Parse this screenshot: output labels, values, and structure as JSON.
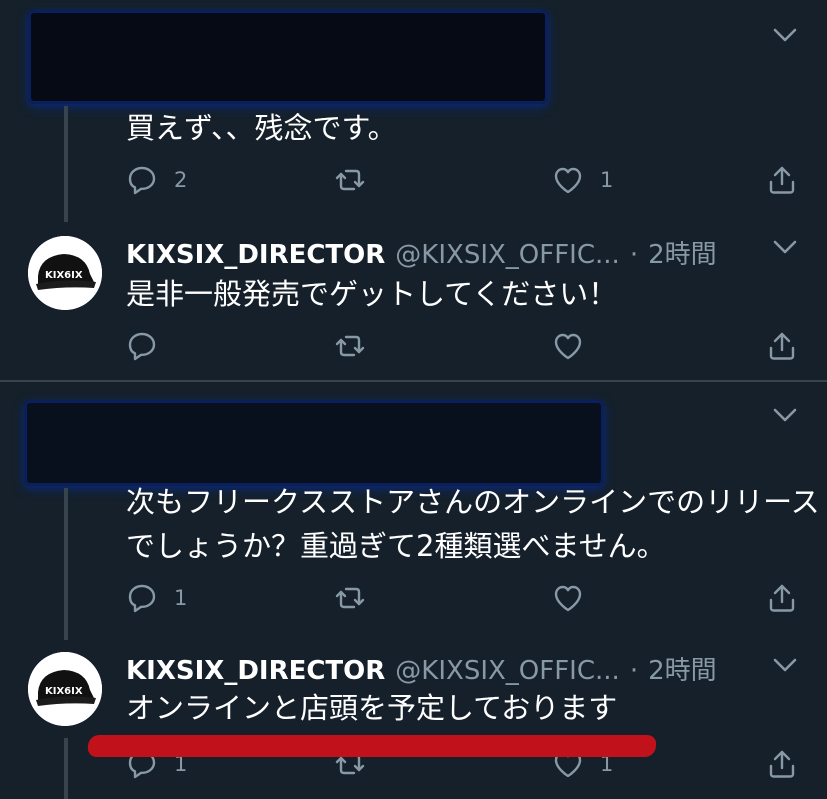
{
  "tweets": [
    {
      "text_lines": [
        "買えず、、残念です。"
      ],
      "reply_count": "2",
      "retweet_count": "",
      "like_count": "1"
    },
    {
      "author_name": "KIXSIX_DIRECTOR",
      "author_handle": "@KIXSIX_OFFIC...",
      "separator": "·",
      "time": "2時間",
      "text_lines": [
        "是非一般発売でゲットしてください！"
      ],
      "reply_count": "",
      "retweet_count": "",
      "like_count": ""
    },
    {
      "text_lines": [
        "次もフリークスストアさんのオンラインでのリリース",
        "でしょうか？重過ぎて2種類選べません。"
      ],
      "reply_count": "1",
      "retweet_count": "",
      "like_count": ""
    },
    {
      "author_name": "KIXSIX_DIRECTOR",
      "author_handle": "@KIXSIX_OFFIC...",
      "separator": "·",
      "time": "2時間",
      "text_lines": [
        "オンラインと店頭を予定しております"
      ],
      "reply_count": "1",
      "retweet_count": "",
      "like_count": "1"
    }
  ],
  "avatar_logo_text": "KIX6IX",
  "icons": {
    "more": "chevron-down-icon",
    "reply": "reply-icon",
    "retweet": "retweet-icon",
    "like": "heart-icon",
    "share": "share-icon"
  },
  "colors": {
    "background": "#15202b",
    "secondary_text": "#8899a6",
    "divider": "#38444d",
    "annotation_red": "#c1121c"
  }
}
